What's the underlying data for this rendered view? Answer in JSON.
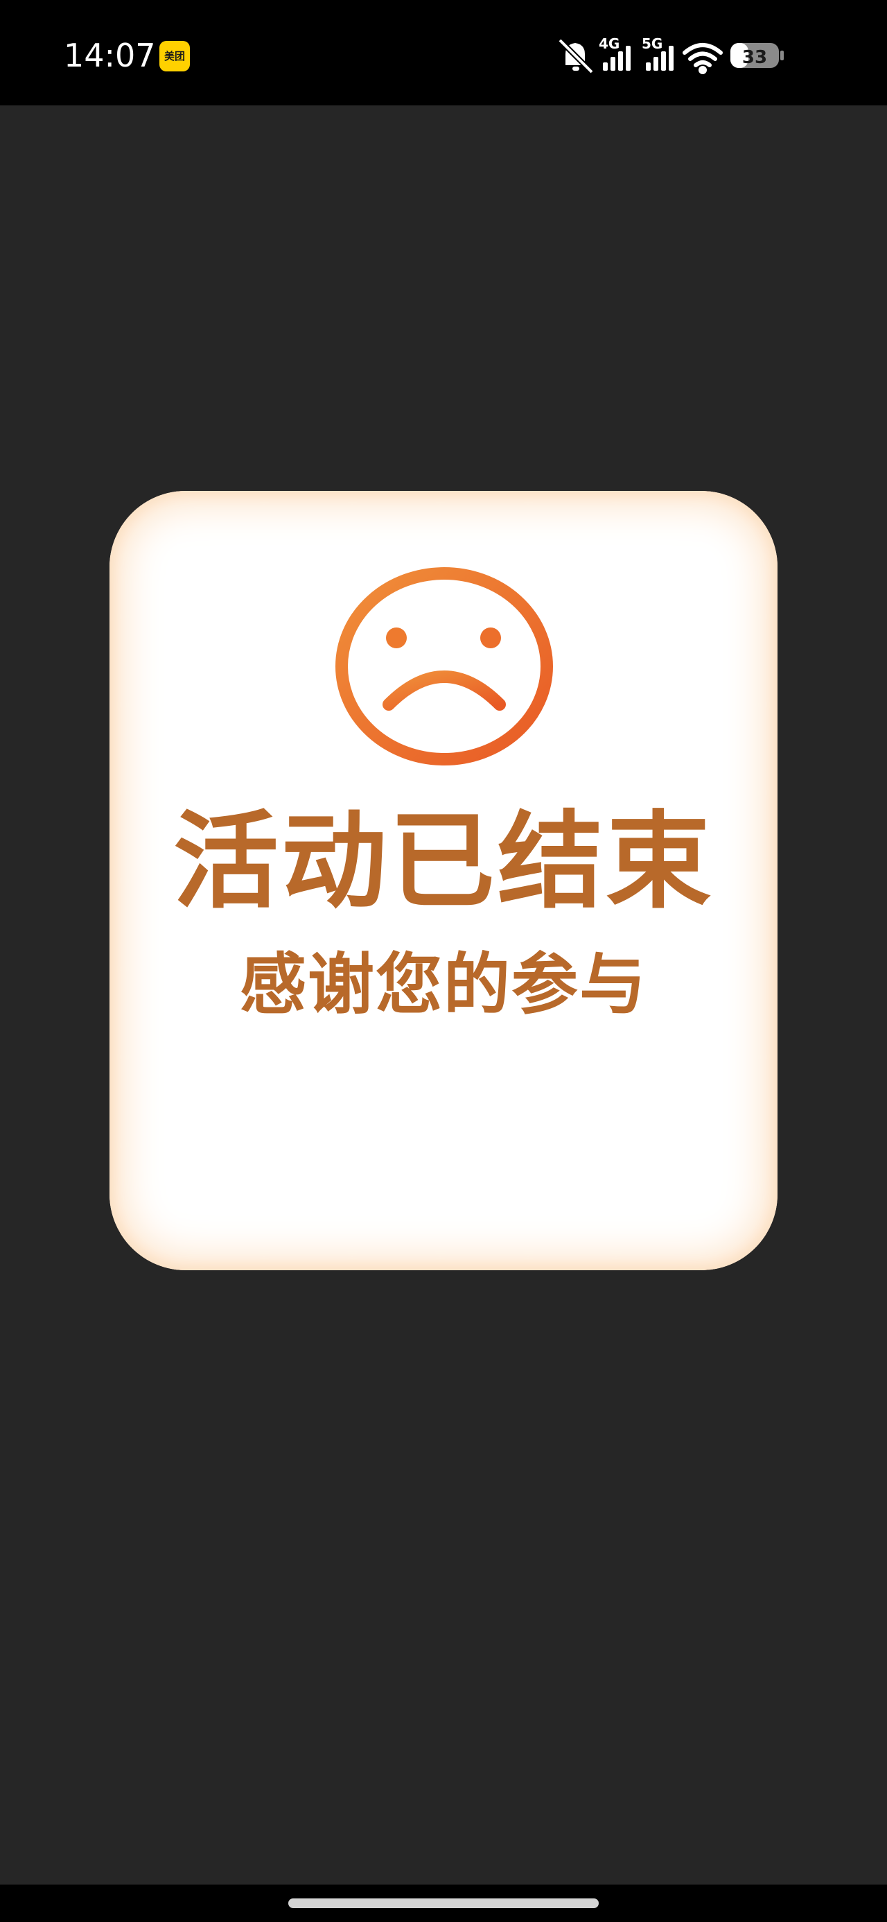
{
  "status_bar": {
    "time": "14:07",
    "app_badge": "美团",
    "network_1": "4G",
    "network_2": "5G",
    "battery_level": "33"
  },
  "card": {
    "icon": "sad-face-icon",
    "title": "活动已结束",
    "subtitle": "感谢您的参与"
  },
  "colors": {
    "background": "#262626",
    "accent_orange": "#ee7a2e",
    "text_brown": "#b8692a",
    "card_glow": "#fde3c8"
  }
}
